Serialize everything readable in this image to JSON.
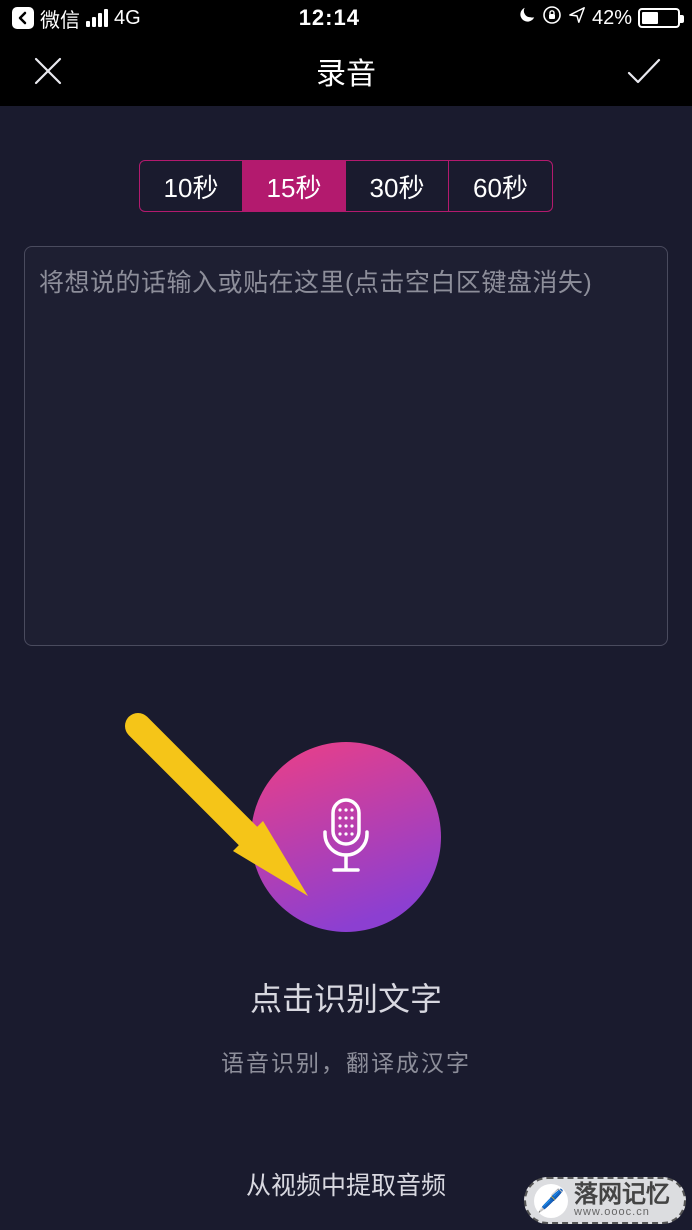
{
  "status": {
    "carrier": "微信",
    "network": "4G",
    "time": "12:14",
    "battery_pct": "42%"
  },
  "nav": {
    "title": "录音"
  },
  "segments": {
    "options": [
      "10秒",
      "15秒",
      "30秒",
      "60秒"
    ],
    "active_index": 1
  },
  "textbox": {
    "placeholder": "将想说的话输入或贴在这里(点击空白区键盘消失)",
    "value": ""
  },
  "record": {
    "title": "点击识别文字",
    "subtitle": "语音识别，翻译成汉字"
  },
  "bottom": {
    "extract_label": "从视频中提取音频"
  },
  "watermark": {
    "name": "落网记忆",
    "url": "www.oooc.cn"
  },
  "icons": {
    "close": "close-icon",
    "confirm": "check-icon",
    "mic": "microphone-icon",
    "moon": "moon-icon",
    "lock": "orientation-lock-icon",
    "location": "location-arrow-icon",
    "back": "back-chevron-icon"
  },
  "colors": {
    "accent": "#b31a6e",
    "gradient_a": "#e43f8c",
    "gradient_b": "#8c3fd1",
    "bg": "#1a1b2e"
  }
}
